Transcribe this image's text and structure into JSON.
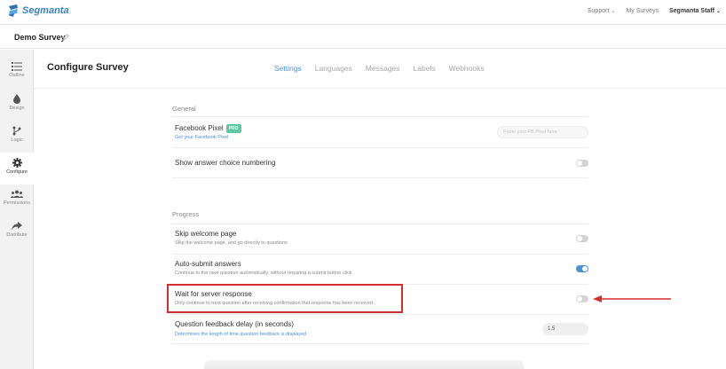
{
  "topbar": {
    "logo_text": "Segmanta",
    "nav": {
      "support": "Support",
      "my_surveys": "My Surveys",
      "user": "Segmanta Staff"
    },
    "chevron": "⌄"
  },
  "survey": {
    "name": "Demo Survey"
  },
  "sidebar": {
    "items": [
      {
        "label": "Outline",
        "icon": "list-icon"
      },
      {
        "label": "Design",
        "icon": "drop-icon"
      },
      {
        "label": "Logic",
        "icon": "branch-icon"
      },
      {
        "label": "Configure",
        "icon": "gear-icon",
        "active": true
      },
      {
        "label": "Permissions",
        "icon": "users-icon"
      },
      {
        "label": "Distribute",
        "icon": "share-icon"
      }
    ]
  },
  "page": {
    "title": "Configure Survey"
  },
  "tabs": [
    {
      "label": "Settings",
      "active": true
    },
    {
      "label": "Languages"
    },
    {
      "label": "Messages"
    },
    {
      "label": "Labels"
    },
    {
      "label": "Webhooks"
    }
  ],
  "general": {
    "title": "General",
    "facebook": {
      "title": "Facebook Pixel",
      "badge": "PRO",
      "link": "Get your Facebook Pixel",
      "placeholder": "Paste your FB Pixel here"
    },
    "numbering": {
      "title": "Show answer choice numbering",
      "on": false
    }
  },
  "progress": {
    "title": "Progress",
    "skip": {
      "title": "Skip welcome page",
      "sub": "Skip the welcome page, and go directly to questions",
      "on": false
    },
    "autosubmit": {
      "title": "Auto-submit answers",
      "sub": "Continue to the next question automatically, without requiring a submit button click",
      "on": true
    },
    "wait": {
      "title": "Wait for server response",
      "sub": "Only continue to next question after receiving confirmation that response has been received",
      "on": false
    },
    "delay": {
      "title": "Question feedback delay (in seconds)",
      "sub": "Determines the length of time question feedback is displayed",
      "value": "1.5"
    }
  },
  "colors": {
    "accent": "#4a90d9",
    "highlight": "#d32f2f",
    "pro_badge": "#5dc9a0"
  }
}
